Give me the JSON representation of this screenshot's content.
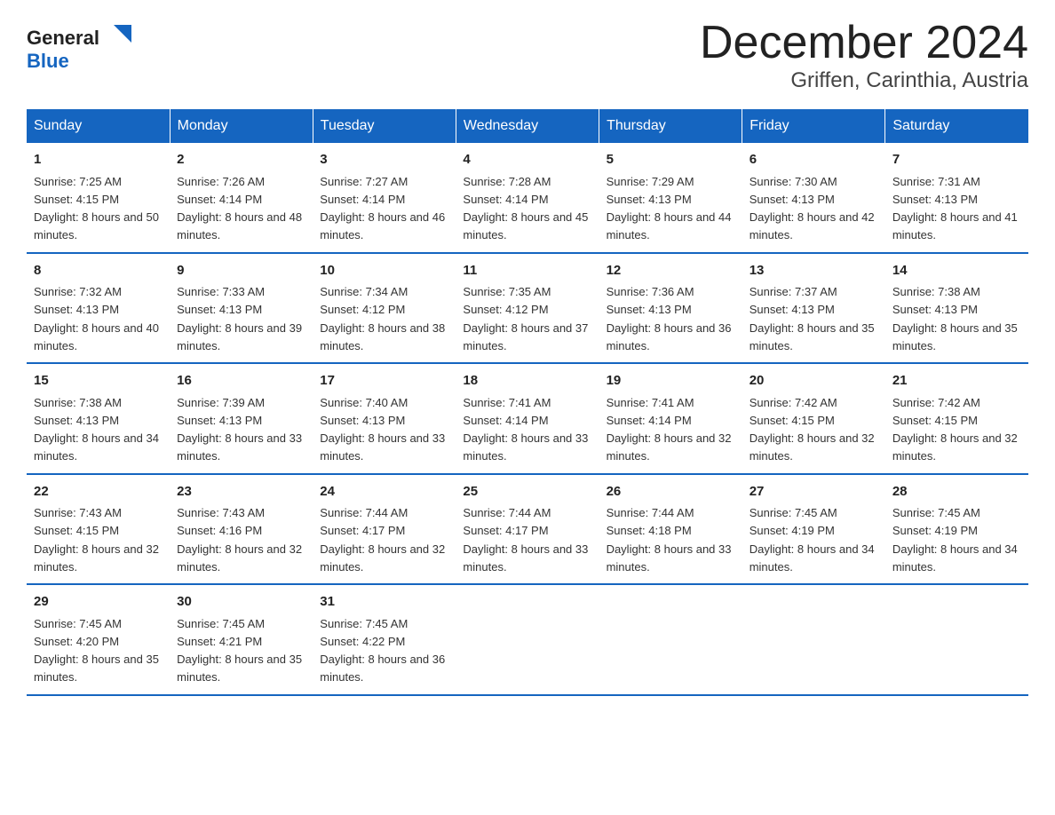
{
  "header": {
    "title": "December 2024",
    "subtitle": "Griffen, Carinthia, Austria",
    "logo_general": "General",
    "logo_blue": "Blue"
  },
  "days_of_week": [
    "Sunday",
    "Monday",
    "Tuesday",
    "Wednesday",
    "Thursday",
    "Friday",
    "Saturday"
  ],
  "weeks": [
    [
      {
        "day": "1",
        "sunrise": "7:25 AM",
        "sunset": "4:15 PM",
        "daylight": "8 hours and 50 minutes."
      },
      {
        "day": "2",
        "sunrise": "7:26 AM",
        "sunset": "4:14 PM",
        "daylight": "8 hours and 48 minutes."
      },
      {
        "day": "3",
        "sunrise": "7:27 AM",
        "sunset": "4:14 PM",
        "daylight": "8 hours and 46 minutes."
      },
      {
        "day": "4",
        "sunrise": "7:28 AM",
        "sunset": "4:14 PM",
        "daylight": "8 hours and 45 minutes."
      },
      {
        "day": "5",
        "sunrise": "7:29 AM",
        "sunset": "4:13 PM",
        "daylight": "8 hours and 44 minutes."
      },
      {
        "day": "6",
        "sunrise": "7:30 AM",
        "sunset": "4:13 PM",
        "daylight": "8 hours and 42 minutes."
      },
      {
        "day": "7",
        "sunrise": "7:31 AM",
        "sunset": "4:13 PM",
        "daylight": "8 hours and 41 minutes."
      }
    ],
    [
      {
        "day": "8",
        "sunrise": "7:32 AM",
        "sunset": "4:13 PM",
        "daylight": "8 hours and 40 minutes."
      },
      {
        "day": "9",
        "sunrise": "7:33 AM",
        "sunset": "4:13 PM",
        "daylight": "8 hours and 39 minutes."
      },
      {
        "day": "10",
        "sunrise": "7:34 AM",
        "sunset": "4:12 PM",
        "daylight": "8 hours and 38 minutes."
      },
      {
        "day": "11",
        "sunrise": "7:35 AM",
        "sunset": "4:12 PM",
        "daylight": "8 hours and 37 minutes."
      },
      {
        "day": "12",
        "sunrise": "7:36 AM",
        "sunset": "4:13 PM",
        "daylight": "8 hours and 36 minutes."
      },
      {
        "day": "13",
        "sunrise": "7:37 AM",
        "sunset": "4:13 PM",
        "daylight": "8 hours and 35 minutes."
      },
      {
        "day": "14",
        "sunrise": "7:38 AM",
        "sunset": "4:13 PM",
        "daylight": "8 hours and 35 minutes."
      }
    ],
    [
      {
        "day": "15",
        "sunrise": "7:38 AM",
        "sunset": "4:13 PM",
        "daylight": "8 hours and 34 minutes."
      },
      {
        "day": "16",
        "sunrise": "7:39 AM",
        "sunset": "4:13 PM",
        "daylight": "8 hours and 33 minutes."
      },
      {
        "day": "17",
        "sunrise": "7:40 AM",
        "sunset": "4:13 PM",
        "daylight": "8 hours and 33 minutes."
      },
      {
        "day": "18",
        "sunrise": "7:41 AM",
        "sunset": "4:14 PM",
        "daylight": "8 hours and 33 minutes."
      },
      {
        "day": "19",
        "sunrise": "7:41 AM",
        "sunset": "4:14 PM",
        "daylight": "8 hours and 32 minutes."
      },
      {
        "day": "20",
        "sunrise": "7:42 AM",
        "sunset": "4:15 PM",
        "daylight": "8 hours and 32 minutes."
      },
      {
        "day": "21",
        "sunrise": "7:42 AM",
        "sunset": "4:15 PM",
        "daylight": "8 hours and 32 minutes."
      }
    ],
    [
      {
        "day": "22",
        "sunrise": "7:43 AM",
        "sunset": "4:15 PM",
        "daylight": "8 hours and 32 minutes."
      },
      {
        "day": "23",
        "sunrise": "7:43 AM",
        "sunset": "4:16 PM",
        "daylight": "8 hours and 32 minutes."
      },
      {
        "day": "24",
        "sunrise": "7:44 AM",
        "sunset": "4:17 PM",
        "daylight": "8 hours and 32 minutes."
      },
      {
        "day": "25",
        "sunrise": "7:44 AM",
        "sunset": "4:17 PM",
        "daylight": "8 hours and 33 minutes."
      },
      {
        "day": "26",
        "sunrise": "7:44 AM",
        "sunset": "4:18 PM",
        "daylight": "8 hours and 33 minutes."
      },
      {
        "day": "27",
        "sunrise": "7:45 AM",
        "sunset": "4:19 PM",
        "daylight": "8 hours and 34 minutes."
      },
      {
        "day": "28",
        "sunrise": "7:45 AM",
        "sunset": "4:19 PM",
        "daylight": "8 hours and 34 minutes."
      }
    ],
    [
      {
        "day": "29",
        "sunrise": "7:45 AM",
        "sunset": "4:20 PM",
        "daylight": "8 hours and 35 minutes."
      },
      {
        "day": "30",
        "sunrise": "7:45 AM",
        "sunset": "4:21 PM",
        "daylight": "8 hours and 35 minutes."
      },
      {
        "day": "31",
        "sunrise": "7:45 AM",
        "sunset": "4:22 PM",
        "daylight": "8 hours and 36 minutes."
      },
      {
        "day": "",
        "sunrise": "",
        "sunset": "",
        "daylight": ""
      },
      {
        "day": "",
        "sunrise": "",
        "sunset": "",
        "daylight": ""
      },
      {
        "day": "",
        "sunrise": "",
        "sunset": "",
        "daylight": ""
      },
      {
        "day": "",
        "sunrise": "",
        "sunset": "",
        "daylight": ""
      }
    ]
  ]
}
